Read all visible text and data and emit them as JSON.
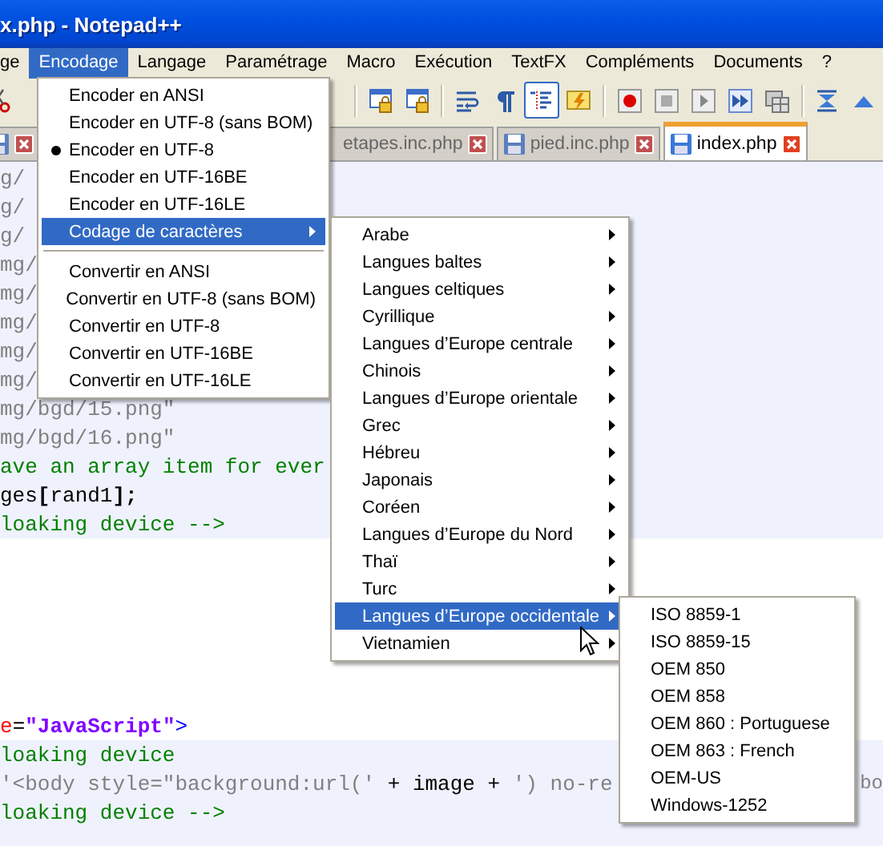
{
  "window": {
    "title": "x.php - Notepad++"
  },
  "menu_bar": [
    {
      "label": "ge",
      "selected": false
    },
    {
      "label": "Encodage",
      "selected": true
    },
    {
      "label": "Langage",
      "selected": false
    },
    {
      "label": "Paramétrage",
      "selected": false
    },
    {
      "label": "Macro",
      "selected": false
    },
    {
      "label": "Exécution",
      "selected": false
    },
    {
      "label": "TextFX",
      "selected": false
    },
    {
      "label": "Compléments",
      "selected": false
    },
    {
      "label": "Documents",
      "selected": false
    },
    {
      "label": "?",
      "selected": false
    }
  ],
  "toolbar_buttons": [
    {
      "pressed": false
    },
    {
      "pressed": false
    },
    {
      "pressed": false
    },
    {
      "pressed": false
    },
    {
      "pressed": false
    },
    {
      "pressed": true
    },
    {
      "pressed": false
    },
    {
      "pressed": false
    },
    {
      "pressed": false
    },
    {
      "pressed": false
    },
    {
      "pressed": false
    },
    {
      "pressed": false
    },
    {
      "pressed": false
    },
    {
      "pressed": false
    }
  ],
  "tabs": [
    {
      "selected": false
    },
    {
      "label": "etapes.inc.php",
      "selected": false
    },
    {
      "label": "pied.inc.php",
      "selected": false
    },
    {
      "label": "index.php",
      "selected": true
    }
  ],
  "editor_lines": [
    {
      "shaded": true,
      "segments": [
        {
          "text": "g/",
          "kind": "string"
        }
      ]
    },
    {
      "shaded": true,
      "segments": [
        {
          "text": "g/",
          "kind": "string"
        }
      ]
    },
    {
      "shaded": true,
      "segments": [
        {
          "text": "g/",
          "kind": "string"
        }
      ]
    },
    {
      "shaded": true,
      "segments": [
        {
          "text": "mg/",
          "kind": "string"
        }
      ]
    },
    {
      "shaded": true,
      "segments": [
        {
          "text": "mg/",
          "kind": "string"
        }
      ]
    },
    {
      "shaded": true,
      "segments": [
        {
          "text": "mg/",
          "kind": "string"
        }
      ]
    },
    {
      "shaded": true,
      "segments": [
        {
          "text": "mg/",
          "kind": "string"
        }
      ]
    },
    {
      "shaded": true,
      "segments": [
        {
          "text": "mg/",
          "kind": "string"
        }
      ]
    },
    {
      "shaded": true,
      "segments": [
        {
          "text": "mg/bgd/15.png\"",
          "kind": "string"
        }
      ]
    },
    {
      "shaded": true,
      "segments": [
        {
          "text": "mg/bgd/16.png\"",
          "kind": "string"
        }
      ]
    },
    {
      "shaded": true,
      "segments": [
        {
          "text": "ave an array item for ever",
          "kind": "comment"
        }
      ]
    },
    {
      "shaded": true,
      "segments": [
        {
          "text": "ges",
          "kind": "plain"
        },
        {
          "text": "[",
          "kind": "operator"
        },
        {
          "text": "rand1",
          "kind": "plain"
        },
        {
          "text": "];",
          "kind": "operator"
        }
      ]
    },
    {
      "shaded": true,
      "segments": [
        {
          "text": "loaking device -->",
          "kind": "comment"
        }
      ]
    },
    {
      "shaded": false
    },
    {
      "shaded": false
    },
    {
      "shaded": false
    },
    {
      "shaded": false
    },
    {
      "shaded": false
    },
    {
      "shaded": false
    },
    {
      "shaded": false,
      "segments": [
        {
          "text": "e",
          "kind": "attribute"
        },
        {
          "text": "=",
          "kind": "plain"
        },
        {
          "text": "\"JavaScript\"",
          "kind": "value"
        },
        {
          "text": ">",
          "kind": "tag"
        }
      ]
    },
    {
      "shaded": true,
      "segments": [
        {
          "text": "loaking device",
          "kind": "comment"
        }
      ]
    },
    {
      "shaded": true,
      "segments": [
        {
          "text": "'<body style=\"background:url('",
          "kind": "string"
        },
        {
          "text": " + image + ",
          "kind": "plain"
        },
        {
          "text": "') no-re",
          "kind": "string"
        }
      ],
      "tail": "bo"
    },
    {
      "shaded": true,
      "segments": [
        {
          "text": "loaking device -->",
          "kind": "comment"
        }
      ]
    }
  ],
  "encoding_menu": [
    {
      "kind": "item",
      "label": "Encoder en ANSI",
      "checked": false,
      "selected": false,
      "submenu": false
    },
    {
      "kind": "item",
      "label": "Encoder en UTF-8 (sans BOM)",
      "checked": false,
      "selected": false,
      "submenu": false
    },
    {
      "kind": "item",
      "label": "Encoder en UTF-8",
      "checked": true,
      "selected": false,
      "submenu": false
    },
    {
      "kind": "item",
      "label": "Encoder en UTF-16BE",
      "checked": false,
      "selected": false,
      "submenu": false
    },
    {
      "kind": "item",
      "label": "Encoder en UTF-16LE",
      "checked": false,
      "selected": false,
      "submenu": false
    },
    {
      "kind": "item",
      "label": "Codage de caractères",
      "checked": false,
      "selected": true,
      "submenu": true
    },
    {
      "kind": "separator"
    },
    {
      "kind": "item",
      "label": "Convertir en ANSI",
      "checked": false,
      "selected": false,
      "submenu": false
    },
    {
      "kind": "item",
      "label": "Convertir en UTF-8 (sans BOM)",
      "checked": false,
      "selected": false,
      "submenu": false
    },
    {
      "kind": "item",
      "label": "Convertir en UTF-8",
      "checked": false,
      "selected": false,
      "submenu": false
    },
    {
      "kind": "item",
      "label": "Convertir en UTF-16BE",
      "checked": false,
      "selected": false,
      "submenu": false
    },
    {
      "kind": "item",
      "label": "Convertir en UTF-16LE",
      "checked": false,
      "selected": false,
      "submenu": false
    }
  ],
  "charset_menu": [
    {
      "label": "Arabe",
      "selected": false,
      "submenu": true
    },
    {
      "label": "Langues baltes",
      "selected": false,
      "submenu": true
    },
    {
      "label": "Langues celtiques",
      "selected": false,
      "submenu": true
    },
    {
      "label": "Cyrillique",
      "selected": false,
      "submenu": true
    },
    {
      "label": "Langues d’Europe centrale",
      "selected": false,
      "submenu": true
    },
    {
      "label": "Chinois",
      "selected": false,
      "submenu": true
    },
    {
      "label": "Langues d’Europe orientale",
      "selected": false,
      "submenu": true
    },
    {
      "label": "Grec",
      "selected": false,
      "submenu": true
    },
    {
      "label": "Hébreu",
      "selected": false,
      "submenu": true
    },
    {
      "label": "Japonais",
      "selected": false,
      "submenu": true
    },
    {
      "label": "Coréen",
      "selected": false,
      "submenu": true
    },
    {
      "label": "Langues d’Europe du Nord",
      "selected": false,
      "submenu": true
    },
    {
      "label": "Thaï",
      "selected": false,
      "submenu": true
    },
    {
      "label": "Turc",
      "selected": false,
      "submenu": true
    },
    {
      "label": "Langues d’Europe occidentale",
      "selected": true,
      "submenu": true
    },
    {
      "label": "Vietnamien",
      "selected": false,
      "submenu": true
    }
  ],
  "western_menu": [
    {
      "label": "ISO 8859-1",
      "selected": false
    },
    {
      "label": "ISO 8859-15",
      "selected": false
    },
    {
      "label": "OEM 850",
      "selected": false
    },
    {
      "label": "OEM 858",
      "selected": false
    },
    {
      "label": "OEM 860 : Portuguese",
      "selected": false
    },
    {
      "label": "OEM 863 : French",
      "selected": false
    },
    {
      "label": "OEM-US",
      "selected": false
    },
    {
      "label": "Windows-1252",
      "selected": false
    }
  ]
}
